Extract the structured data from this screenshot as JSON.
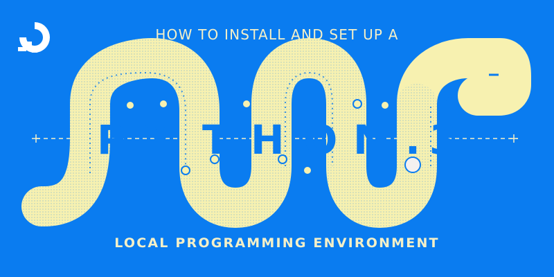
{
  "brand": {
    "logo_icon": "digitalocean-logo-icon"
  },
  "header": {
    "title": "HOW TO INSTALL AND SET UP A"
  },
  "wordmark": {
    "letters": [
      "P",
      "Y",
      "T",
      "H",
      "O",
      "N",
      ".",
      "3"
    ]
  },
  "footer": {
    "subtitle": "LOCAL PROGRAMMING ENVIRONMENT"
  },
  "colors": {
    "background": "#0a7cf0",
    "snake": "#f7f1b0",
    "snake_shade": "#d9e8c8",
    "accent_text": "#f4f0c8",
    "letter": "#0a7cf0",
    "guide_line": "#f4f0c8"
  },
  "icons": [
    "digitalocean-logo-icon",
    "arrow-up-icon",
    "plus-icon"
  ]
}
